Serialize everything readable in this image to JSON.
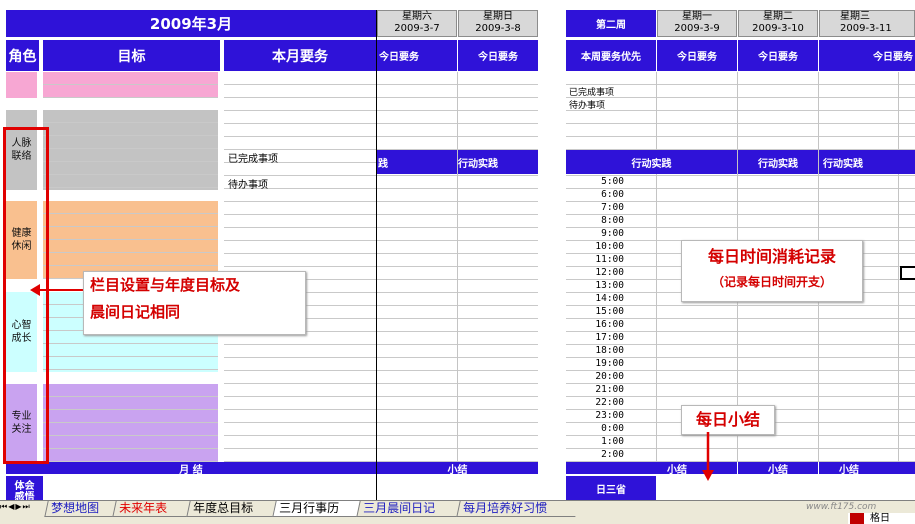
{
  "left": {
    "month_title": "2009年3月",
    "col_role": "角色",
    "col_goal": "目标",
    "col_monthly_tasks": "本月要务",
    "important_items": "已完成事项",
    "todo_items": "待办事项",
    "roles": [
      "人脉\n联络",
      "健康\n休闲",
      "心智\n成长",
      "专业\n关注"
    ],
    "month_summary": "月 结",
    "reflection": "体会\n感悟"
  },
  "week1": {
    "days": [
      {
        "weekday": "星期六",
        "date": "2009-3-7"
      },
      {
        "weekday": "星期日",
        "date": "2009-3-8"
      }
    ],
    "daily_tasks": "今日要务",
    "action_partial": "践",
    "action": "行动实践",
    "summary": "小结"
  },
  "week2": {
    "label": "第二周",
    "priority": "本周要务优先",
    "days": [
      {
        "weekday": "星期一",
        "date": "2009-3-9"
      },
      {
        "weekday": "星期二",
        "date": "2009-3-10"
      },
      {
        "weekday": "星期三",
        "date": "2009-3-11"
      }
    ],
    "daily_tasks": "今日要务",
    "important_items": "已完成事项",
    "todo_items": "待办事项",
    "action": "行动实践",
    "summary": "小结",
    "day3": "日三省",
    "hours": [
      "5:00",
      "6:00",
      "7:00",
      "8:00",
      "9:00",
      "10:00",
      "11:00",
      "12:00",
      "13:00",
      "14:00",
      "15:00",
      "16:00",
      "17:00",
      "18:00",
      "19:00",
      "20:00",
      "21:00",
      "22:00",
      "23:00",
      "0:00",
      "1:00",
      "2:00"
    ]
  },
  "annotations": {
    "left_note_line1": "栏目设置与年度目标及",
    "left_note_line2": "晨间日记相同",
    "time_note_title": "每日时间消耗记录",
    "time_note_sub": "（记录每日时间开支）",
    "summary_note": "每日小结"
  },
  "sheet_tabs": [
    "梦想地图",
    "未来年表",
    "年度总目标",
    "三月行事历",
    "三月晨间日记",
    "每月培养好习惯"
  ],
  "active_tab": "三月行事历",
  "watermark": "www.ft175.com",
  "status_partial": "格日"
}
